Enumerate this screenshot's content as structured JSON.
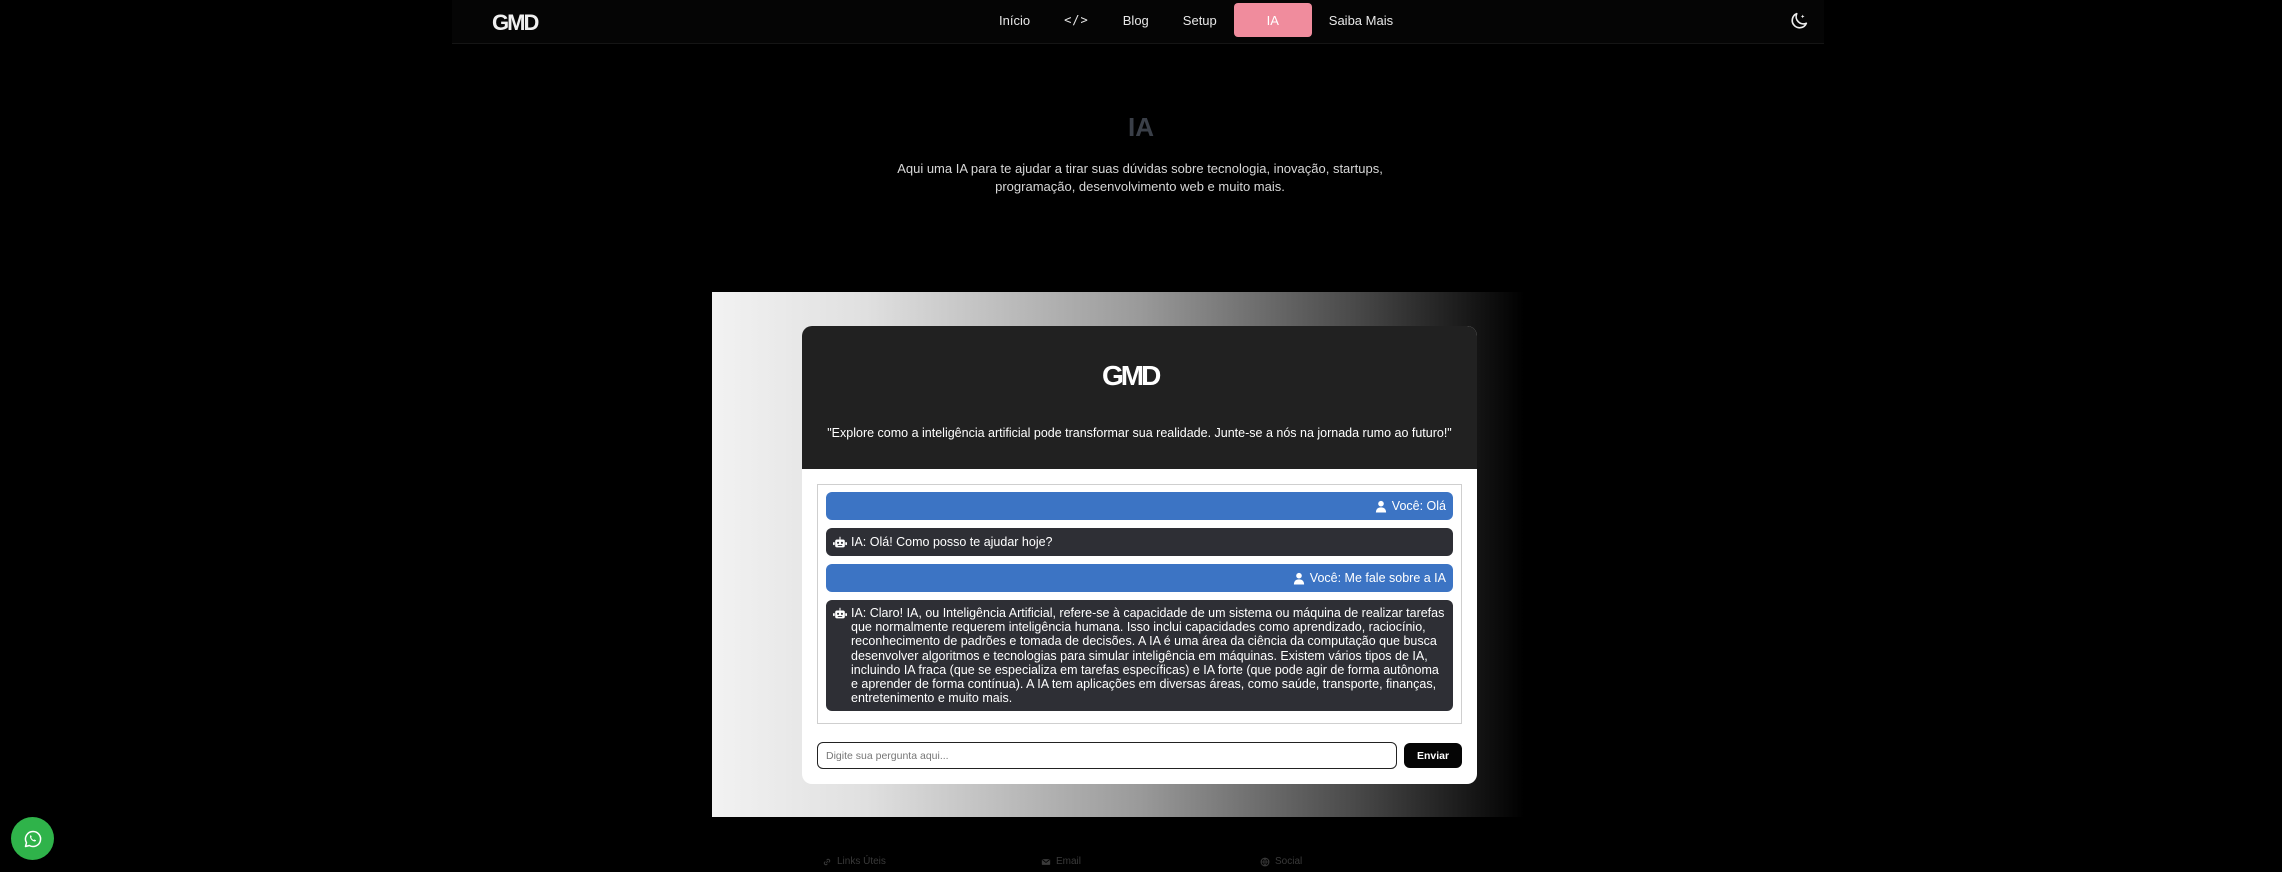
{
  "nav": {
    "logo_text": "GMD",
    "items": [
      {
        "label": "Início"
      },
      {
        "label": "</>"
      },
      {
        "label": "Blog"
      },
      {
        "label": "Setup"
      },
      {
        "label": "IA"
      },
      {
        "label": "Saiba Mais"
      }
    ],
    "active_color": "#f08c9d",
    "theme_icon": "moon-icon"
  },
  "hero": {
    "title": "IA",
    "description": "Aqui uma IA para te ajudar a tirar suas dúvidas sobre tecnologia, inovação, startups, programação, desenvolvimento web e muito mais."
  },
  "chat": {
    "logo_text": "GMD",
    "tagline": "\"Explore como a inteligência artificial pode transformar sua realidade. Junte-se a nós na jornada rumo ao futuro!\"",
    "messages": [
      {
        "role": "user",
        "icon": "user-icon",
        "text": "Você: Olá"
      },
      {
        "role": "ai",
        "icon": "robot-icon",
        "text": "IA: Olá! Como posso te ajudar hoje?"
      },
      {
        "role": "user",
        "icon": "user-icon",
        "text": "Você: Me fale sobre a IA"
      },
      {
        "role": "ai",
        "icon": "robot-icon",
        "text": "IA: Claro! IA, ou Inteligência Artificial, refere-se à capacidade de um sistema ou máquina de realizar tarefas que normalmente requerem inteligência humana. Isso inclui capacidades como aprendizado, raciocínio, reconhecimento de padrões e tomada de decisões. A IA é uma área da ciência da computação que busca desenvolver algoritmos e tecnologias para simular inteligência em máquinas. Existem vários tipos de IA, incluindo IA fraca (que se especializa em tarefas específicas) e IA forte (que pode agir de forma autônoma e aprender de forma contínua). A IA tem aplicações em diversas áreas, como saúde, transporte, finanças, entretenimento e muito mais."
      }
    ],
    "input_placeholder": "Digite sua pergunta aqui...",
    "send_label": "Enviar",
    "user_bubble_color": "#3c74c4",
    "ai_bubble_color": "#2e2f35"
  },
  "footer": {
    "links": [
      {
        "label": "Links Úteis",
        "icon": "link-icon"
      },
      {
        "label": "Email",
        "icon": "mail-icon"
      },
      {
        "label": "Social",
        "icon": "globe-icon"
      }
    ]
  },
  "whatsapp": {
    "icon": "whatsapp-icon",
    "color": "#2fb34a"
  }
}
